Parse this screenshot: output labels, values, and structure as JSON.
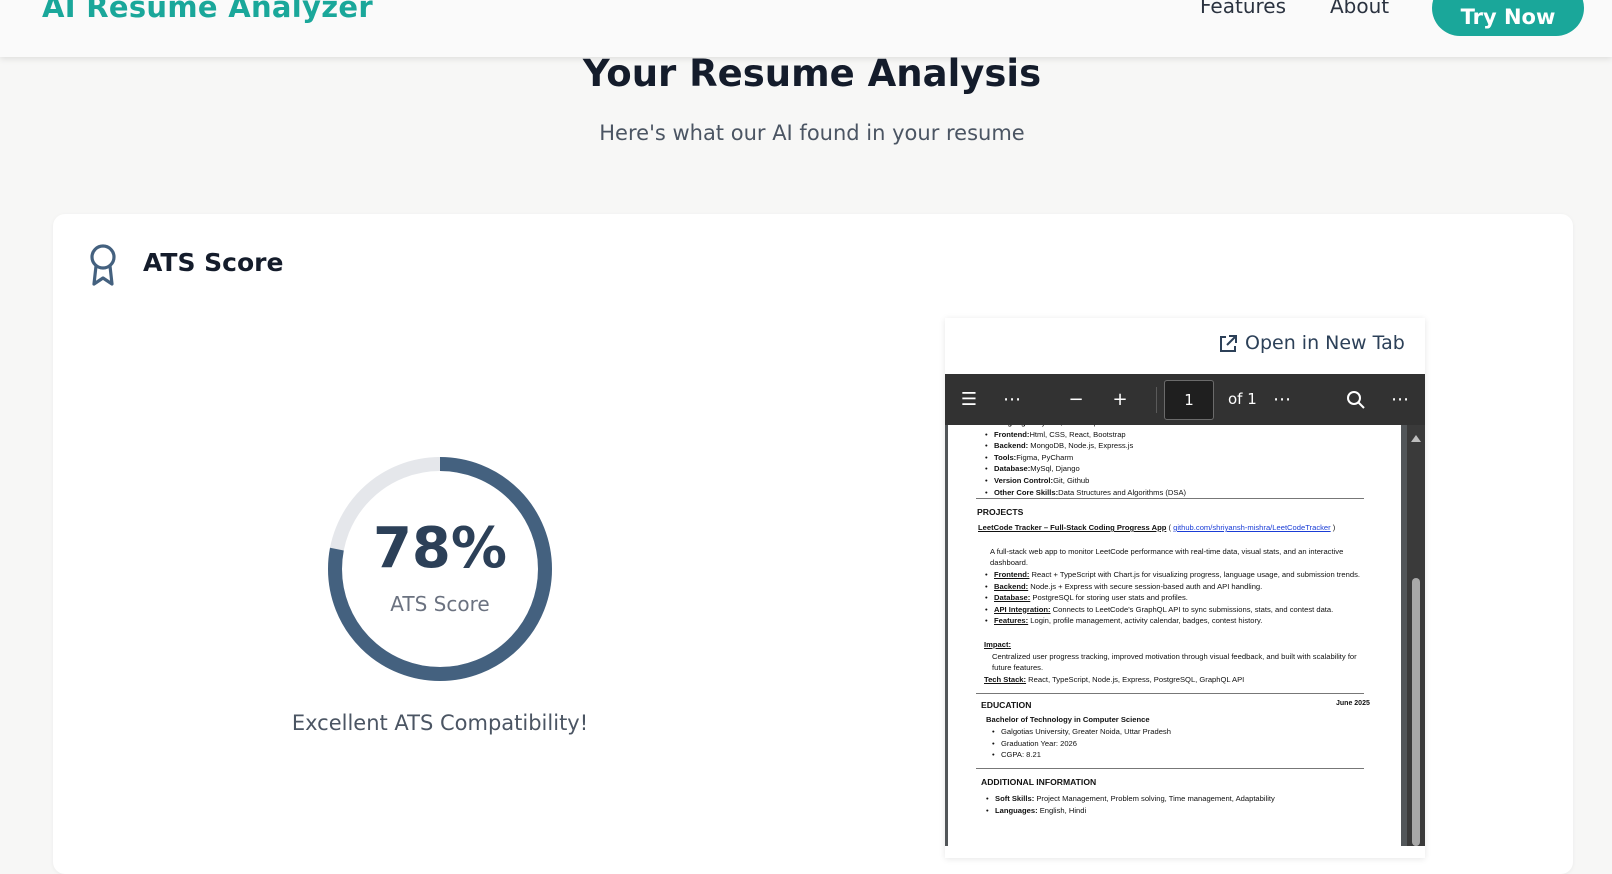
{
  "header": {
    "brand": "AI Resume Analyzer",
    "nav": {
      "features": "Features",
      "about": "About"
    },
    "cta": "Try Now"
  },
  "hero": {
    "title": "Your Resume Analysis",
    "subtitle": "Here's what our AI found in your resume"
  },
  "ats": {
    "section_title": "ATS Score",
    "score_text": "78%",
    "score_percent": 78,
    "score_label": "ATS Score",
    "caption": "Excellent ATS Compatibility!",
    "ring_color": "#44617f",
    "track_color": "#e5e7eb"
  },
  "preview": {
    "open_tab": "Open in New Tab",
    "toolbar": {
      "page": "1",
      "of": "of 1"
    },
    "skills": [
      {
        "label": "Languages:",
        "value": "Python, JavaScript"
      },
      {
        "label": "Frontend:",
        "value": "Html, CSS, React, Bootstrap"
      },
      {
        "label": "Backend:",
        "value": " MongoDB, Node.js, Express.js"
      },
      {
        "label": "Tools:",
        "value": "Figma, PyCharm"
      },
      {
        "label": "Database:",
        "value": "MySql, Django"
      },
      {
        "label": "Version Control:",
        "value": "Git, Github"
      },
      {
        "label": "Other Core Skills:",
        "value": "Data Structures and Algorithms (DSA)"
      }
    ],
    "projects_heading": "PROJECTS",
    "project_title": "LeetCode Tracker – Full-Stack Coding Progress App",
    "project_link": "github.com/shriyansh-mishra/LeetCodeTracker",
    "project_desc_1": "A full-stack web app to monitor LeetCode performance with real-time data, visual stats, and an interactive",
    "project_desc_2": "dashboard.",
    "project_points": [
      {
        "label": "Frontend:",
        "value": " React + TypeScript with Chart.js for visualizing progress, language usage, and submission trends."
      },
      {
        "label": "Backend:",
        "value": " Node.js + Express with secure session-based auth and API handling."
      },
      {
        "label": "Database:",
        "value": " PostgreSQL for storing user stats and profiles."
      },
      {
        "label": "API Integration:",
        "value": " Connects to LeetCode's GraphQL API to sync submissions, stats, and contest data."
      },
      {
        "label": "Features:",
        "value": " Login, profile management, activity calendar, badges, contest history."
      }
    ],
    "impact_label": "Impact:",
    "impact_1": "Centralized user progress tracking, improved motivation through visual feedback, and built with scalability for",
    "impact_2": "future features.",
    "tech_label": "Tech Stack:",
    "tech_value": " React, TypeScript, Node.js, Express, PostgreSQL, GraphQL API",
    "education_heading": "EDUCATION",
    "education_date": "June 2025",
    "degree": "Bachelor of Technology in Computer Science",
    "education_points": [
      "Galgotias University, Greater Noida, Uttar Pradesh",
      "Graduation Year: 2026",
      "CGPA: 8.21"
    ],
    "additional_heading": "ADDITIONAL INFORMATION",
    "additional_points": [
      {
        "label": "Soft Skills:",
        "value": " Project Management, Problem solving, Time management, Adaptability"
      },
      {
        "label": "Languages:",
        "value": " English, Hindi"
      }
    ]
  }
}
